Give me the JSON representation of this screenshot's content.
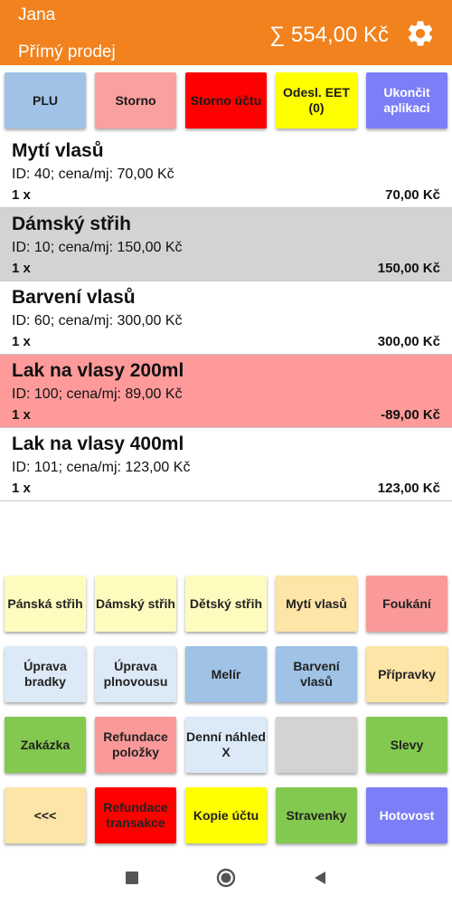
{
  "header": {
    "user": "Jana",
    "mode": "Přímý prodej",
    "total": "∑ 554,00 Kč",
    "settings_icon": "gear-icon",
    "color": "#f1821e"
  },
  "toolbar": {
    "plu": "PLU",
    "storno": "Storno",
    "storno_uctu": "Storno účtu",
    "odesl_eet": "Odesl. EET (0)",
    "ukoncit": "Ukončit aplikaci"
  },
  "items": [
    {
      "name": "Mytí vlasů",
      "info": "ID: 40; cena/mj: 70,00 Kč",
      "qty": "1 x",
      "price": "70,00 Kč"
    },
    {
      "name": "Dámský střih",
      "info": "ID: 10; cena/mj: 150,00 Kč",
      "qty": "1 x",
      "price": "150,00 Kč"
    },
    {
      "name": "Barvení vlasů",
      "info": "ID: 60; cena/mj: 300,00 Kč",
      "qty": "1 x",
      "price": "300,00 Kč"
    },
    {
      "name": "Lak na vlasy 200ml",
      "info": "ID: 100; cena/mj: 89,00 Kč",
      "qty": "1 x",
      "price": "-89,00 Kč"
    },
    {
      "name": "Lak na vlasy 400ml",
      "info": "ID: 101; cena/mj: 123,00 Kč",
      "qty": "1 x",
      "price": "123,00 Kč"
    }
  ],
  "grid": {
    "r1": [
      "Pánská střih",
      "Dámský střih",
      "Dětský střih",
      "Mytí vlasů",
      "Foukání"
    ],
    "r2": [
      "Úprava bradky",
      "Úprava plnovousu",
      "Melír",
      "Barvení vlasů",
      "Přípravky"
    ],
    "r3": [
      "Zakázka",
      "Refundace položky",
      "Denní náhled X",
      "",
      "Slevy"
    ],
    "r4": [
      "<<<",
      "Refundace transakce",
      "Kopie účtu",
      "Stravenky",
      "Hotovost"
    ]
  },
  "navbar": {
    "icons": [
      "recent-apps-icon",
      "home-icon",
      "back-icon"
    ]
  }
}
